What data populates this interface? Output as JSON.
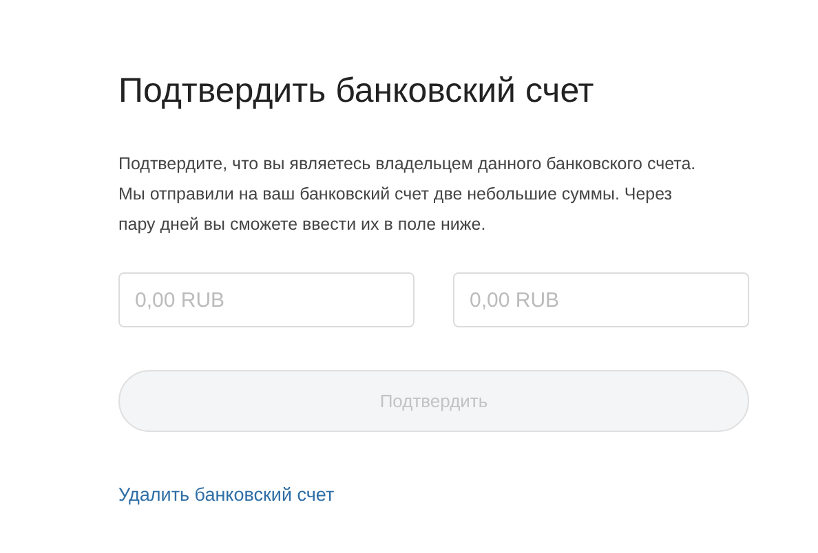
{
  "title": "Подтвердить банковский счет",
  "description": "Подтвердите, что вы являетесь владельцем данного банковского счета. Мы отправили на ваш банковский счет две небольшие суммы. Через пару дней вы сможете ввести их в поле ниже.",
  "amount_fields": [
    {
      "placeholder": "0,00 RUB"
    },
    {
      "placeholder": "0,00 RUB"
    }
  ],
  "confirm_button": {
    "label": "Подтвердить",
    "disabled": true
  },
  "delete_link": "Удалить банковский счет"
}
